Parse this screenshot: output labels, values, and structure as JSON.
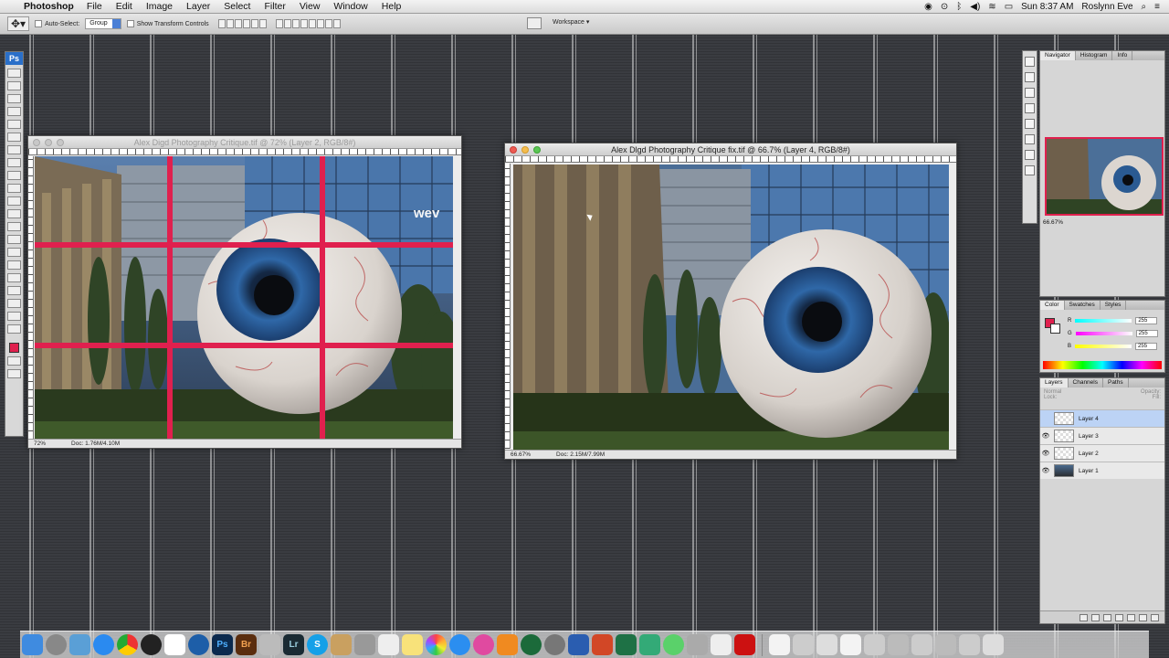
{
  "menubar": {
    "app_name": "Photoshop",
    "items": [
      "File",
      "Edit",
      "Image",
      "Layer",
      "Select",
      "Filter",
      "View",
      "Window",
      "Help"
    ],
    "clock": "Sun 8:37 AM",
    "user": "Roslynn Eve"
  },
  "options_bar": {
    "auto_select_label": "Auto-Select:",
    "auto_select_value": "Group",
    "show_transform_label": "Show Transform Controls",
    "workspace_label": "Workspace"
  },
  "toolbox": {
    "logo": "Ps",
    "foreground_color": "#e0204e"
  },
  "doc_left": {
    "title": "Alex Digd Photography Critique.tif @ 72% (Layer 2, RGB/8#)",
    "zoom": "72%",
    "doc_size": "Doc: 1.76M/4.10M",
    "sign_text": "wev",
    "guide_color": "#e0204e"
  },
  "doc_right": {
    "title": "Alex Dlgd Photography Critique fix.tif @ 66.7% (Layer 4, RGB/8#)",
    "zoom": "66.67%",
    "doc_size": "Doc: 2.15M/7.99M"
  },
  "navigator": {
    "tabs": [
      "Navigator",
      "Histogram",
      "Info"
    ],
    "zoom": "66.67%"
  },
  "color_panel": {
    "tabs": [
      "Color",
      "Swatches",
      "Styles"
    ],
    "r_label": "R",
    "r_value": "255",
    "g_label": "G",
    "g_value": "255",
    "b_label": "B",
    "b_value": "255"
  },
  "layers_panel": {
    "tabs": [
      "Layers",
      "Channels",
      "Paths"
    ],
    "blend_mode": "Normal",
    "opacity_label": "Opacity:",
    "lock_label": "Lock:",
    "fill_label": "Fill:",
    "layers": [
      {
        "name": "Layer 4",
        "visible": false,
        "selected": true
      },
      {
        "name": "Layer 3",
        "visible": true,
        "selected": false
      },
      {
        "name": "Layer 2",
        "visible": true,
        "selected": false
      },
      {
        "name": "Layer 1",
        "visible": true,
        "selected": false
      }
    ]
  },
  "dock": {
    "labels": [
      "Ps",
      "Br",
      "Lr",
      "S"
    ]
  }
}
